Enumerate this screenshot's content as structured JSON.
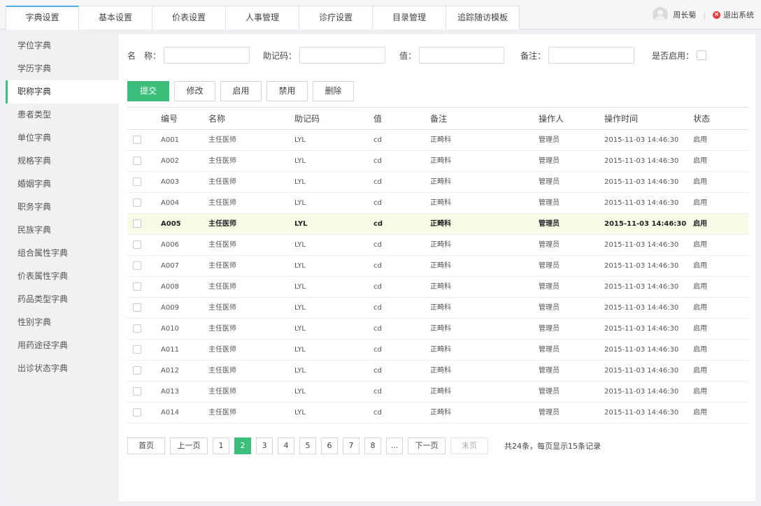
{
  "tabs": [
    "字典设置",
    "基本设置",
    "价表设置",
    "人事管理",
    "诊疗设置",
    "目录管理",
    "追踪随访模板"
  ],
  "user": {
    "name": "周长菊",
    "logout": "退出系统"
  },
  "sidebar": {
    "items": [
      "学位字典",
      "学历字典",
      "职称字典",
      "患者类型",
      "单位字典",
      "规格字典",
      "婚姻字典",
      "职务字典",
      "民族字典",
      "组合属性字典",
      "价表属性字典",
      "药品类型字典",
      "性别字典",
      "用药途径字典",
      "出诊状态字典"
    ],
    "active_index": 2
  },
  "search": {
    "name_label": "名　称：",
    "mnemonic_label": "助记码：",
    "value_label": "值：",
    "note_label": "备注：",
    "enabled_label": "是否启用："
  },
  "buttons": {
    "submit": "提交",
    "edit": "修改",
    "enable": "启用",
    "disable": "禁用",
    "delete": "删除"
  },
  "table": {
    "headers": {
      "code": "编号",
      "name": "名称",
      "mnemonic": "助记码",
      "value": "值",
      "note": "备注",
      "operator": "操作人",
      "time": "操作时间",
      "status": "状态"
    },
    "highlight_index": 4,
    "rows": [
      {
        "code": "A001",
        "name": "主任医师",
        "mnemonic": "LYL",
        "value": "cd",
        "note": "正畸科",
        "operator": "管理员",
        "time": "2015-11-03 14:46:30",
        "status": "启用"
      },
      {
        "code": "A002",
        "name": "主任医师",
        "mnemonic": "LYL",
        "value": "cd",
        "note": "正畸科",
        "operator": "管理员",
        "time": "2015-11-03 14:46:30",
        "status": "启用"
      },
      {
        "code": "A003",
        "name": "主任医师",
        "mnemonic": "LYL",
        "value": "cd",
        "note": "正畸科",
        "operator": "管理员",
        "time": "2015-11-03 14:46:30",
        "status": "启用"
      },
      {
        "code": "A004",
        "name": "主任医师",
        "mnemonic": "LYL",
        "value": "cd",
        "note": "正畸科",
        "operator": "管理员",
        "time": "2015-11-03 14:46:30",
        "status": "启用"
      },
      {
        "code": "A005",
        "name": "主任医师",
        "mnemonic": "LYL",
        "value": "cd",
        "note": "正畸科",
        "operator": "管理员",
        "time": "2015-11-03 14:46:30",
        "status": "启用"
      },
      {
        "code": "A006",
        "name": "主任医师",
        "mnemonic": "LYL",
        "value": "cd",
        "note": "正畸科",
        "operator": "管理员",
        "time": "2015-11-03 14:46:30",
        "status": "启用"
      },
      {
        "code": "A007",
        "name": "主任医师",
        "mnemonic": "LYL",
        "value": "cd",
        "note": "正畸科",
        "operator": "管理员",
        "time": "2015-11-03 14:46:30",
        "status": "启用"
      },
      {
        "code": "A008",
        "name": "主任医师",
        "mnemonic": "LYL",
        "value": "cd",
        "note": "正畸科",
        "operator": "管理员",
        "time": "2015-11-03 14:46:30",
        "status": "启用"
      },
      {
        "code": "A009",
        "name": "主任医师",
        "mnemonic": "LYL",
        "value": "cd",
        "note": "正畸科",
        "operator": "管理员",
        "time": "2015-11-03 14:46:30",
        "status": "启用"
      },
      {
        "code": "A010",
        "name": "主任医师",
        "mnemonic": "LYL",
        "value": "cd",
        "note": "正畸科",
        "operator": "管理员",
        "time": "2015-11-03 14:46:30",
        "status": "启用"
      },
      {
        "code": "A011",
        "name": "主任医师",
        "mnemonic": "LYL",
        "value": "cd",
        "note": "正畸科",
        "operator": "管理员",
        "time": "2015-11-03 14:46:30",
        "status": "启用"
      },
      {
        "code": "A012",
        "name": "主任医师",
        "mnemonic": "LYL",
        "value": "cd",
        "note": "正畸科",
        "operator": "管理员",
        "time": "2015-11-03 14:46:30",
        "status": "启用"
      },
      {
        "code": "A013",
        "name": "主任医师",
        "mnemonic": "LYL",
        "value": "cd",
        "note": "正畸科",
        "operator": "管理员",
        "time": "2015-11-03 14:46:30",
        "status": "启用"
      },
      {
        "code": "A014",
        "name": "主任医师",
        "mnemonic": "LYL",
        "value": "cd",
        "note": "正畸科",
        "operator": "管理员",
        "time": "2015-11-03 14:46:30",
        "status": "启用"
      }
    ]
  },
  "pagination": {
    "first": "首页",
    "prev": "上一页",
    "pages": [
      "1",
      "2",
      "3",
      "4",
      "5",
      "6",
      "7",
      "8",
      "..."
    ],
    "current": "2",
    "next": "下一页",
    "last": "末页",
    "info": "共24条，每页显示15条记录"
  },
  "colors": {
    "accent": "#3cbf7a",
    "tab_active": "#4ab0e0",
    "highlight_row": "#fafbe6",
    "logout": "#e0413e"
  }
}
